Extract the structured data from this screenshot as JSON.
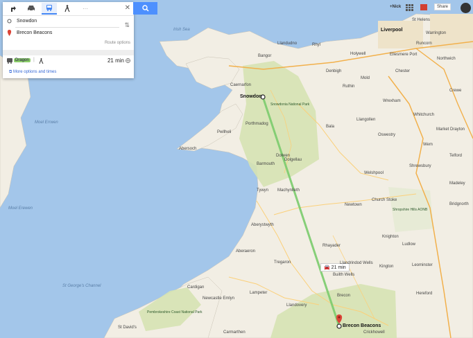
{
  "panel": {
    "mode_close": "✕",
    "origin": "Snowdon",
    "destination": "Brecon Beacons",
    "swap": "⇅",
    "route_options": "Route options",
    "result": {
      "operator": "Dragon",
      "duration": "21 min"
    },
    "more_options": "More options and times"
  },
  "topbar": {
    "user": "+Nick",
    "share": "Share"
  },
  "map": {
    "route_time": "21 min",
    "start_label": "Snowdon",
    "end_label": "Brecon Beacons",
    "places": [
      {
        "id": "liverpool",
        "text": "Liverpool",
        "big": true
      },
      {
        "id": "chester",
        "text": "Chester"
      },
      {
        "id": "wrexham",
        "text": "Wrexham"
      },
      {
        "id": "shrewsbury",
        "text": "Shrewsbury"
      },
      {
        "id": "telford",
        "text": "Telford"
      },
      {
        "id": "aberystwyth",
        "text": "Aberystwyth"
      },
      {
        "id": "newtown",
        "text": "Newtown"
      },
      {
        "id": "bangor",
        "text": "Bangor"
      },
      {
        "id": "caernarfon",
        "text": "Caernarfon"
      },
      {
        "id": "porthmadog",
        "text": "Porthmadog"
      },
      {
        "id": "barmouth",
        "text": "Barmouth"
      },
      {
        "id": "hereford",
        "text": "Hereford"
      },
      {
        "id": "carmarthen",
        "text": "Carmarthen"
      },
      {
        "id": "rhyl",
        "text": "Rhyl"
      },
      {
        "id": "llandudno",
        "text": "Llandudno"
      },
      {
        "id": "crewe",
        "text": "Crewe"
      },
      {
        "id": "northwich",
        "text": "Northwich"
      },
      {
        "id": "machynlleth",
        "text": "Machynlleth"
      },
      {
        "id": "lampeter",
        "text": "Lampeter"
      },
      {
        "id": "ludlow",
        "text": "Ludlow"
      },
      {
        "id": "whitchurch",
        "text": "Whitchurch"
      },
      {
        "id": "oswestry",
        "text": "Oswestry"
      },
      {
        "id": "dolgellau",
        "text": "Dolgellau"
      },
      {
        "id": "aberaeron",
        "text": "Aberaeron"
      },
      {
        "id": "tregaron",
        "text": "Tregaron"
      },
      {
        "id": "llandrindod",
        "text": "Llandrindod Wells"
      },
      {
        "id": "brecon",
        "text": "Brecon"
      },
      {
        "id": "llandovery",
        "text": "Llandovery"
      },
      {
        "id": "holywell",
        "text": "Holywell"
      },
      {
        "id": "mold",
        "text": "Mold"
      },
      {
        "id": "ellesmere",
        "text": "Ellesmere Port"
      },
      {
        "id": "runcorn",
        "text": "Runcorn"
      },
      {
        "id": "sthelens",
        "text": "St Helens"
      },
      {
        "id": "warrington",
        "text": "Warrington"
      },
      {
        "id": "pwllheli",
        "text": "Pwllheli"
      },
      {
        "id": "abersoch",
        "text": "Abersoch"
      },
      {
        "id": "cardigan",
        "text": "Cardigan"
      },
      {
        "id": "newcastleemlyn",
        "text": "Newcastle Emlyn"
      },
      {
        "id": "rhayader",
        "text": "Rhayader"
      },
      {
        "id": "welshpool",
        "text": "Welshpool"
      },
      {
        "id": "kington",
        "text": "Kington"
      },
      {
        "id": "leominster",
        "text": "Leominster"
      },
      {
        "id": "bridgnorth",
        "text": "Bridgnorth"
      },
      {
        "id": "madeley",
        "text": "Madeley"
      },
      {
        "id": "marketdrayton",
        "text": "Market Drayton"
      },
      {
        "id": "wem",
        "text": "Wem"
      },
      {
        "id": "denbigh",
        "text": "Denbigh"
      },
      {
        "id": "ruthin",
        "text": "Ruthin"
      },
      {
        "id": "llangollen",
        "text": "Llangollen"
      },
      {
        "id": "bala",
        "text": "Bala"
      },
      {
        "id": "crickhowell",
        "text": "Crickhowell"
      },
      {
        "id": "builth",
        "text": "Builth Wells"
      },
      {
        "id": "knighton",
        "text": "Knighton"
      },
      {
        "id": "churchstoke",
        "text": "Church Stoke"
      },
      {
        "id": "towyn",
        "text": "Tywyn"
      },
      {
        "id": "dolwen",
        "text": "Dolwen"
      },
      {
        "id": "stdavids",
        "text": "St David's"
      }
    ],
    "seas": [
      {
        "id": "irishsea",
        "text": "Irish Sea"
      },
      {
        "id": "moelerwern",
        "text": "Moel Errwen"
      },
      {
        "id": "moelera",
        "text": "Moel Erewen"
      },
      {
        "id": "stgeorge",
        "text": "St George's Channel"
      }
    ],
    "parks": [
      {
        "id": "snowdonia",
        "text": "Snowdonia National Park"
      },
      {
        "id": "pembroke",
        "text": "Pembrokeshire Coast National Park"
      },
      {
        "id": "shropshirehills",
        "text": "Shropshire Hills AONB"
      }
    ]
  }
}
